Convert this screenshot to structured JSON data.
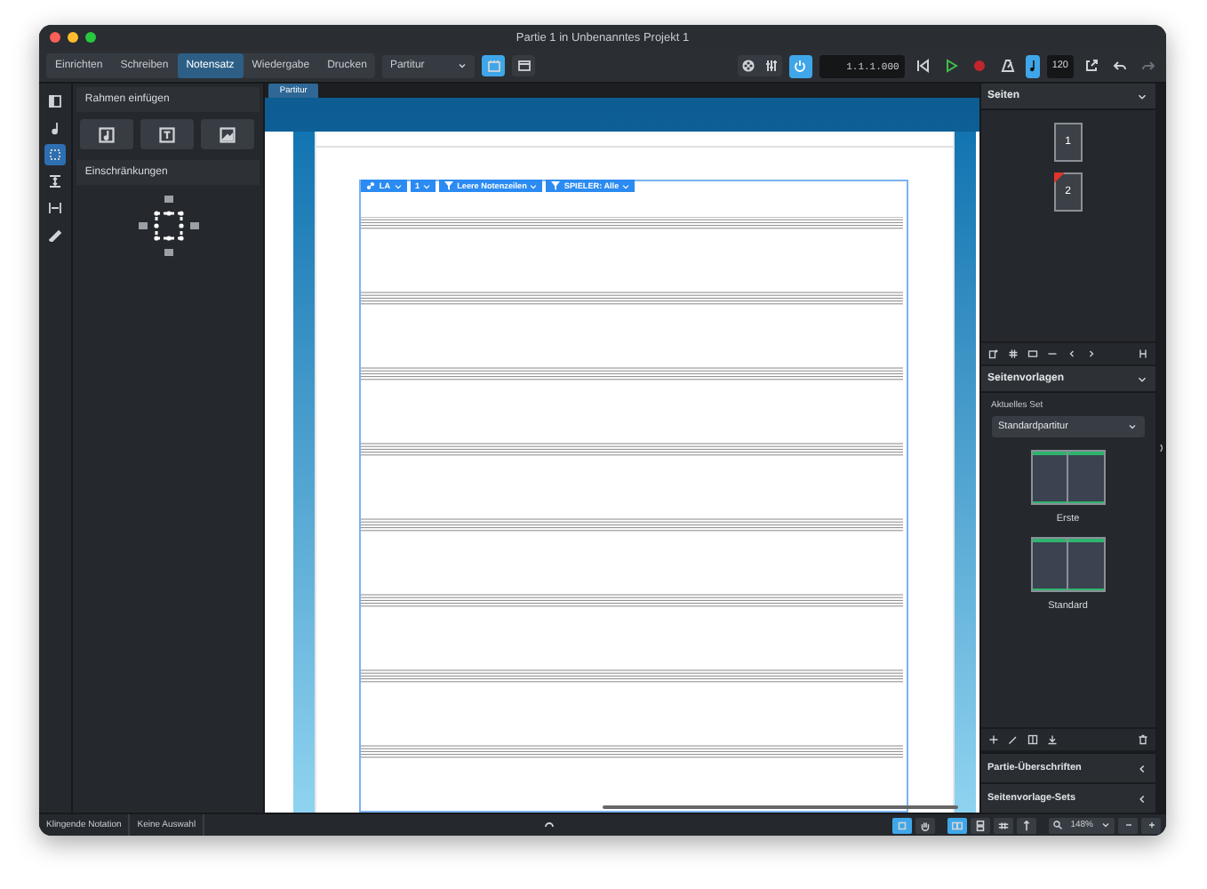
{
  "window": {
    "title": "Partie 1 in Unbenanntes Projekt 1"
  },
  "mode_tabs": [
    {
      "label": "Einrichten",
      "selected": false
    },
    {
      "label": "Schreiben",
      "selected": false
    },
    {
      "label": "Notensatz",
      "selected": true
    },
    {
      "label": "Wiedergabe",
      "selected": false
    },
    {
      "label": "Drucken",
      "selected": false
    }
  ],
  "layout_dropdown": {
    "value": "Partitur"
  },
  "view_buttons": [
    {
      "selected": true
    },
    {
      "selected": false
    }
  ],
  "transport": {
    "power_on": true,
    "time": "1.1.1.000",
    "click_on": true,
    "tempo": "120"
  },
  "left_toolbar": [
    {
      "selected": false
    },
    {
      "selected": false
    },
    {
      "selected": true
    },
    {
      "selected": false
    },
    {
      "selected": false
    },
    {
      "selected": false
    }
  ],
  "insert_frames": {
    "title": "Rahmen einfügen"
  },
  "constraints": {
    "title": "Einschränkungen"
  },
  "layout_tab": {
    "label": "Partitur"
  },
  "filters": [
    {
      "kind": "link",
      "label": "LA"
    },
    {
      "kind": "plain",
      "label": "1"
    },
    {
      "kind": "filter",
      "label": "Leere Notenzeilen"
    },
    {
      "kind": "filter",
      "label": "SPIELER: Alle"
    }
  ],
  "pages_panel": {
    "title": "Seiten",
    "pages": [
      {
        "label": "1",
        "flagged": false
      },
      {
        "label": "2",
        "flagged": true
      }
    ]
  },
  "page_templates_panel": {
    "title": "Seitenvorlagen",
    "set_label": "Aktuelles Set",
    "set": "Standardpartitur",
    "templates": [
      {
        "label": "Erste"
      },
      {
        "label": "Standard"
      }
    ]
  },
  "collapsed_panels": [
    {
      "title": "Partie-Überschriften"
    },
    {
      "title": "Seitenvorlage-Sets"
    }
  ],
  "status_bar": {
    "left": [
      "Klingende Notation",
      "Keine Auswahl"
    ],
    "tool_buttons": [
      {
        "selected": true
      },
      {
        "selected": false
      }
    ],
    "view_buttons": [
      {
        "selected": true
      },
      {
        "selected": false
      },
      {
        "selected": false
      },
      {
        "selected": false
      }
    ],
    "zoom": "148%"
  }
}
